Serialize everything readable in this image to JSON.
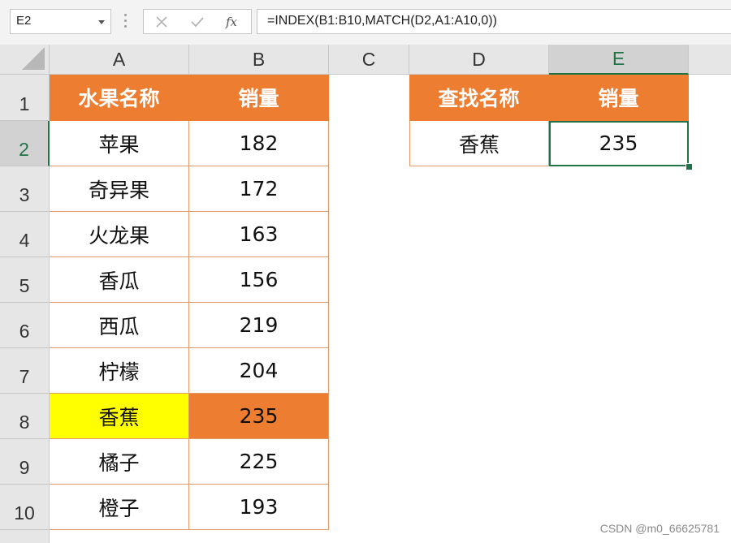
{
  "formula_bar": {
    "name_box": "E2",
    "cancel_icon": "cancel-x-icon",
    "enter_icon": "checkmark-icon",
    "fx_icon": "fx-icon",
    "formula": "=INDEX(B1:B10,MATCH(D2,A1:A10,0))"
  },
  "columns": [
    "A",
    "B",
    "C",
    "D",
    "E"
  ],
  "rows": [
    "1",
    "2",
    "3",
    "4",
    "5",
    "6",
    "7",
    "8",
    "9",
    "10"
  ],
  "table1": {
    "header": [
      "水果名称",
      "销量"
    ],
    "rows": [
      [
        "苹果",
        "182"
      ],
      [
        "奇异果",
        "172"
      ],
      [
        "火龙果",
        "163"
      ],
      [
        "香瓜",
        "156"
      ],
      [
        "西瓜",
        "219"
      ],
      [
        "柠檬",
        "204"
      ],
      [
        "香蕉",
        "235"
      ],
      [
        "橘子",
        "225"
      ],
      [
        "橙子",
        "193"
      ]
    ]
  },
  "table2": {
    "header": [
      "查找名称",
      "销量"
    ],
    "row": [
      "香蕉",
      "235"
    ]
  },
  "selected_cell": "E2",
  "colors": {
    "header_fill": "#ed7d31",
    "highlight_yellow": "#ffff00",
    "highlight_orange": "#ed7d31",
    "selection": "#217346"
  },
  "watermark": "CSDN @m0_66625781"
}
